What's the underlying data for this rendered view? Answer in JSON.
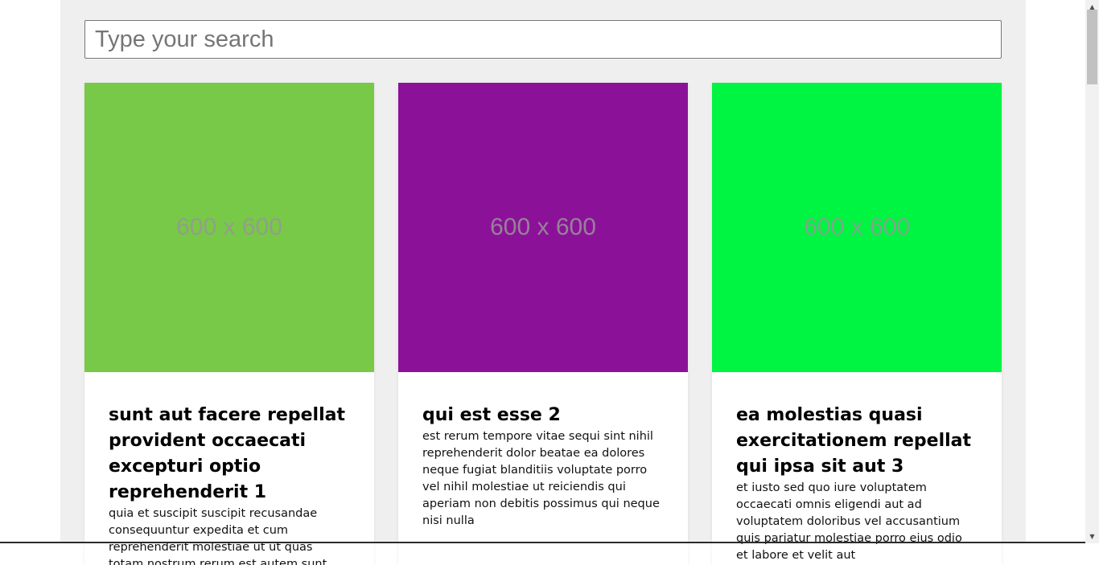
{
  "search": {
    "placeholder": "Type your search",
    "value": ""
  },
  "cards": [
    {
      "image_label": "600 x 600",
      "image_color": "#78c947",
      "title": "sunt aut facere repellat provident occaecati excepturi optio reprehenderit 1",
      "body": "quia et suscipit suscipit recusandae consequuntur expedita et cum reprehenderit molestiae ut ut quas totam nostrum rerum est autem sunt rem eveniet architecto"
    },
    {
      "image_label": "600 x 600",
      "image_color": "#8b1298",
      "title": "qui est esse 2",
      "body": "est rerum tempore vitae sequi sint nihil reprehenderit dolor beatae ea dolores neque fugiat blanditiis voluptate porro vel nihil molestiae ut reiciendis qui aperiam non debitis possimus qui neque nisi nulla"
    },
    {
      "image_label": "600 x 600",
      "image_color": "#00f442",
      "title": "ea molestias quasi exercitationem repellat qui ipsa sit aut 3",
      "body": "et iusto sed quo iure voluptatem occaecati omnis eligendi aut ad voluptatem doloribus vel accusantium quis pariatur molestiae porro eius odio et labore et velit aut"
    }
  ],
  "scrollbar": {
    "up_icon": "chevron-up-icon",
    "down_icon": "chevron-down-icon"
  }
}
